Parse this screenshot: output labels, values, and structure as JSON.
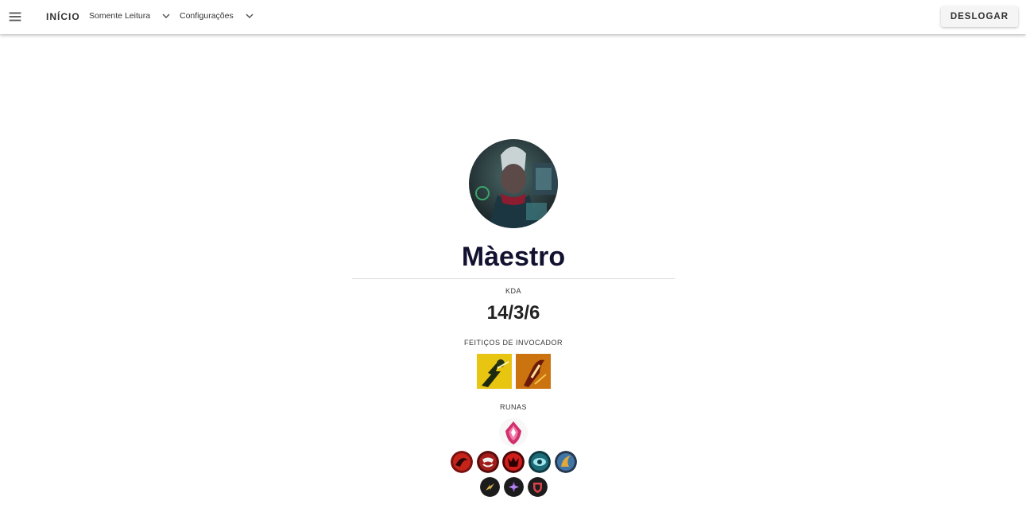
{
  "topbar": {
    "menu_icon": "menu-icon",
    "home_label": "INÍCIO",
    "readonly_label": "Somente Leitura",
    "settings_label": "Configurações",
    "logout_label": "DESLOGAR"
  },
  "profile": {
    "name": "Màestro",
    "kda_label": "KDA",
    "kda_value": "14/3/6",
    "spells_label": "FEITIÇOS DE INVOCADOR",
    "runes_label": "RUNAS",
    "spells": [
      "flash-spell-icon",
      "ignite-spell-icon"
    ],
    "keystone_rune": "electrocute-rune-icon",
    "primary_runes": [
      "cheap-shot-rune-icon",
      "taste-of-blood-rune-icon",
      "sudden-impact-rune-icon",
      "zombie-ward-rune-icon",
      "ultimate-hunter-rune-icon"
    ],
    "shards": [
      "adaptive-shard-icon",
      "adaptive-force-shard-icon",
      "armor-shard-icon"
    ]
  },
  "colors": {
    "name": "#121230",
    "spell_bg": "#e6b800",
    "rune_red": "#b3201c",
    "rune_teal": "#1b6a7a"
  }
}
